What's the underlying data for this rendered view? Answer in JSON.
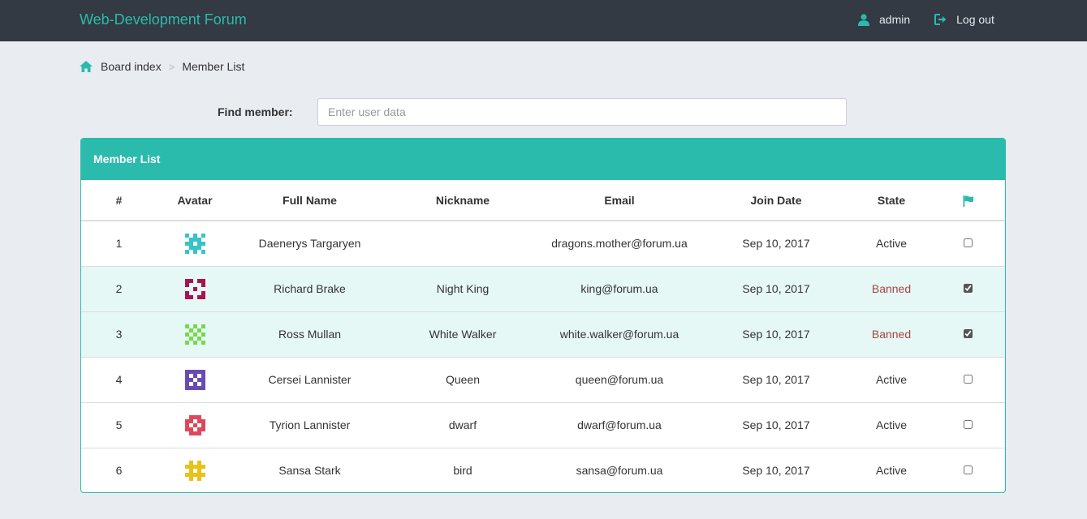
{
  "navbar": {
    "brand": "Web-Development Forum",
    "user_label": "admin",
    "logout_label": "Log out",
    "accent": "#2bbbad"
  },
  "breadcrumb": {
    "home_label": "Board index",
    "separator": ">",
    "current": "Member List"
  },
  "search": {
    "label": "Find member:",
    "placeholder": "Enter user data",
    "value": ""
  },
  "panel": {
    "title": "Member List",
    "columns": [
      "#",
      "Avatar",
      "Full Name",
      "Nickname",
      "Email",
      "Join Date",
      "State"
    ],
    "flag_icon": "flag-icon"
  },
  "members": [
    {
      "num": "1",
      "full_name": "Daenerys Targaryen",
      "nickname": "",
      "email": "dragons.mother@forum.ua",
      "join_date": "Sep 10, 2017",
      "state": "Active",
      "checked": false,
      "avatar_color": "#35c4c7"
    },
    {
      "num": "2",
      "full_name": "Richard Brake",
      "nickname": "Night King",
      "email": "king@forum.ua",
      "join_date": "Sep 10, 2017",
      "state": "Banned",
      "checked": true,
      "avatar_color": "#a8124f"
    },
    {
      "num": "3",
      "full_name": "Ross Mullan",
      "nickname": "White Walker",
      "email": "white.walker@forum.ua",
      "join_date": "Sep 10, 2017",
      "state": "Banned",
      "checked": true,
      "avatar_color": "#76d84a"
    },
    {
      "num": "4",
      "full_name": "Cersei Lannister",
      "nickname": "Queen",
      "email": "queen@forum.ua",
      "join_date": "Sep 10, 2017",
      "state": "Active",
      "checked": false,
      "avatar_color": "#6a4bb4"
    },
    {
      "num": "5",
      "full_name": "Tyrion Lannister",
      "nickname": "dwarf",
      "email": "dwarf@forum.ua",
      "join_date": "Sep 10, 2017",
      "state": "Active",
      "checked": false,
      "avatar_color": "#e0475a"
    },
    {
      "num": "6",
      "full_name": "Sansa Stark",
      "nickname": "bird",
      "email": "sansa@forum.ua",
      "join_date": "Sep 10, 2017",
      "state": "Active",
      "checked": false,
      "avatar_color": "#e8c21a"
    }
  ]
}
